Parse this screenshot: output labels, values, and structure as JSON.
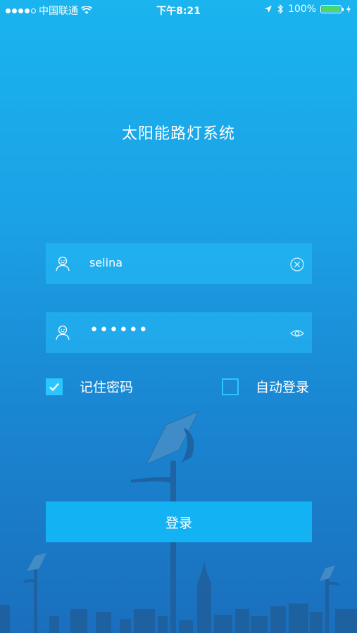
{
  "status_bar": {
    "carrier": "中国联通",
    "time": "下午8:21",
    "battery": "100%"
  },
  "app": {
    "title": "太阳能路灯系统"
  },
  "form": {
    "username": "selina",
    "password_masked": "••••••",
    "remember_label": "记住密码",
    "remember_checked": true,
    "auto_login_label": "自动登录",
    "auto_login_checked": false,
    "login_label": "登录"
  },
  "colors": {
    "bg_top": "#1ab4ef",
    "bg_bottom": "#1a6fbd",
    "accent": "#13b2f2",
    "battery": "#4cd964"
  },
  "icons": [
    "signal-icon",
    "wifi-icon",
    "location-arrow-icon",
    "bluetooth-icon",
    "battery-icon",
    "charging-icon",
    "user-icon",
    "clear-icon",
    "eye-icon",
    "checkmark-icon"
  ]
}
